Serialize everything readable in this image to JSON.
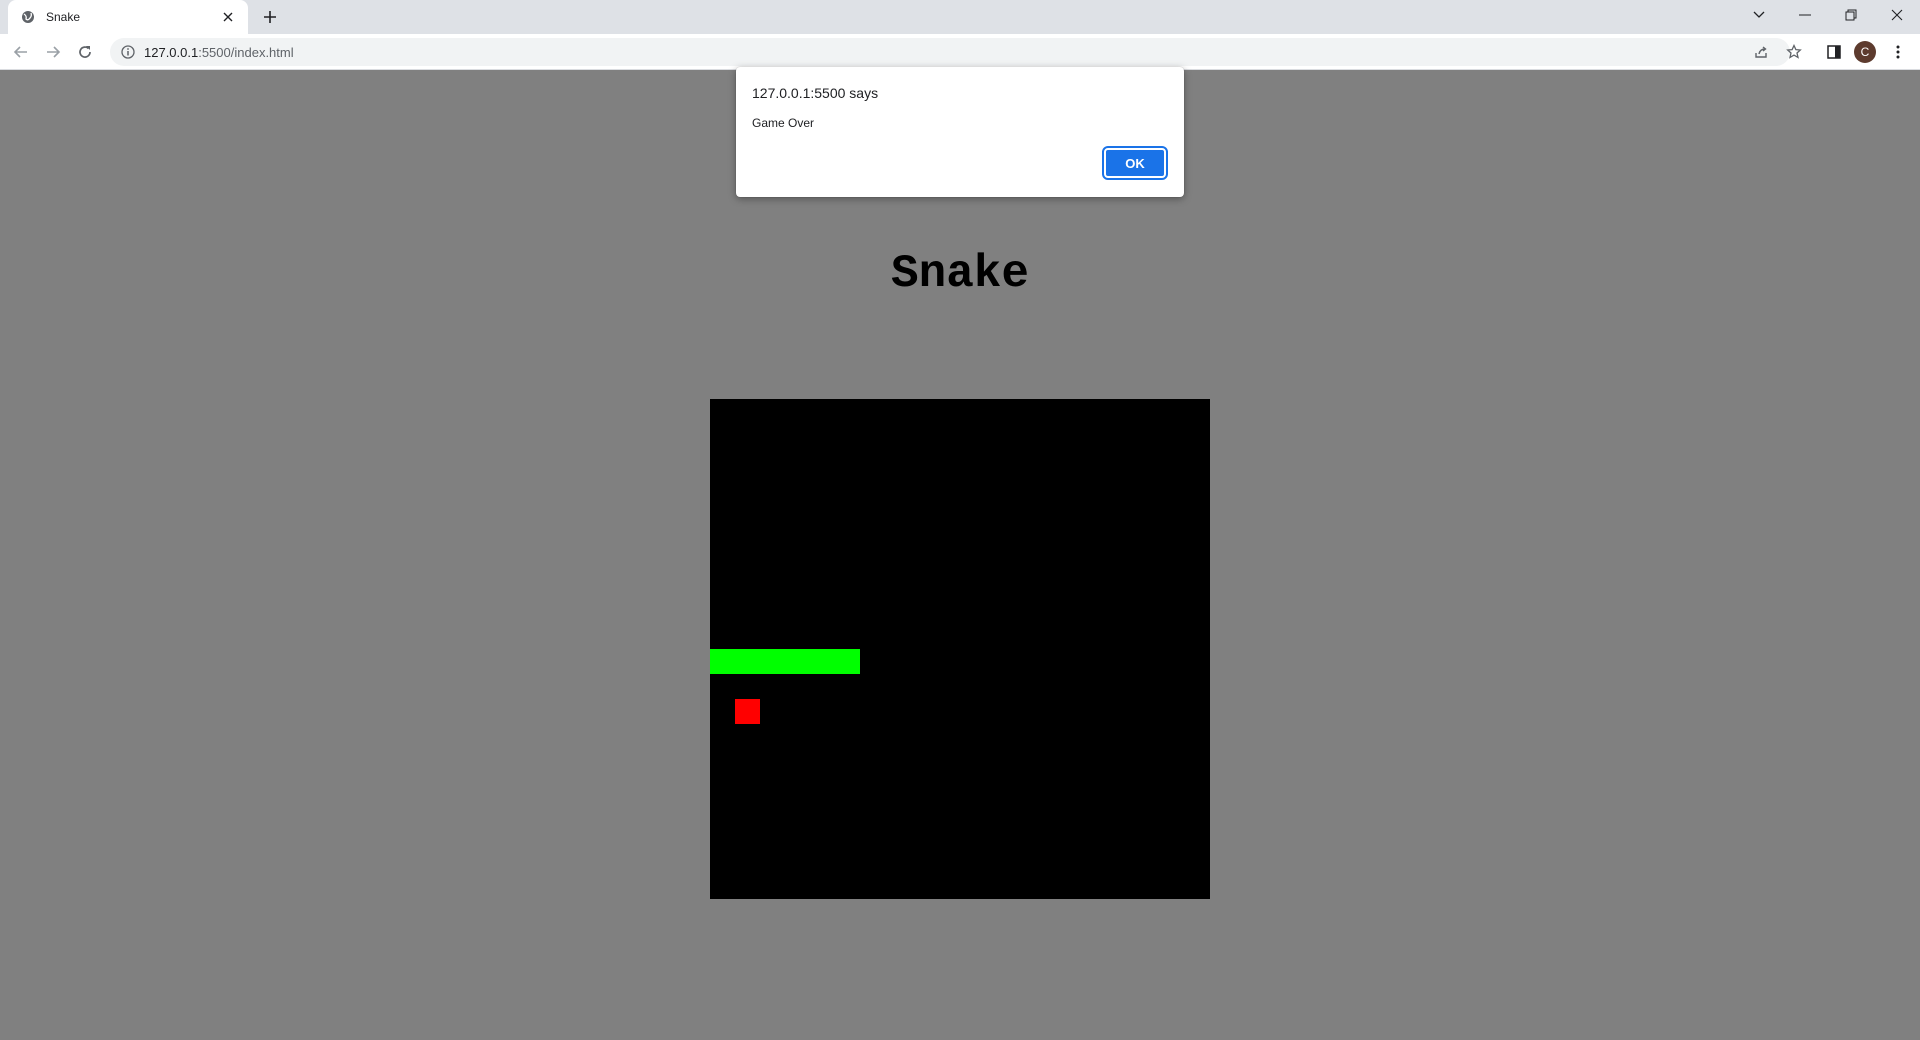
{
  "browser": {
    "tab": {
      "title": "Snake",
      "favicon": "globe-icon"
    },
    "address": {
      "host": "127.0.0.1",
      "path": ":5500/index.html"
    },
    "avatar_letter": "C"
  },
  "page": {
    "title": "Snake",
    "background_color": "#808080"
  },
  "game": {
    "grid": {
      "columns": 20,
      "rows": 20
    },
    "board_color": "#000000",
    "snake_color": "#00ff00",
    "food_color": "#ff0000",
    "snake_cells": [
      [
        0,
        10
      ],
      [
        1,
        10
      ],
      [
        2,
        10
      ],
      [
        3,
        10
      ],
      [
        4,
        10
      ],
      [
        5,
        10
      ]
    ],
    "food_cell": [
      1,
      12
    ]
  },
  "dialog": {
    "title": "127.0.0.1:5500 says",
    "message": "Game Over",
    "ok_label": "OK",
    "ok_color": "#1a73e8"
  }
}
